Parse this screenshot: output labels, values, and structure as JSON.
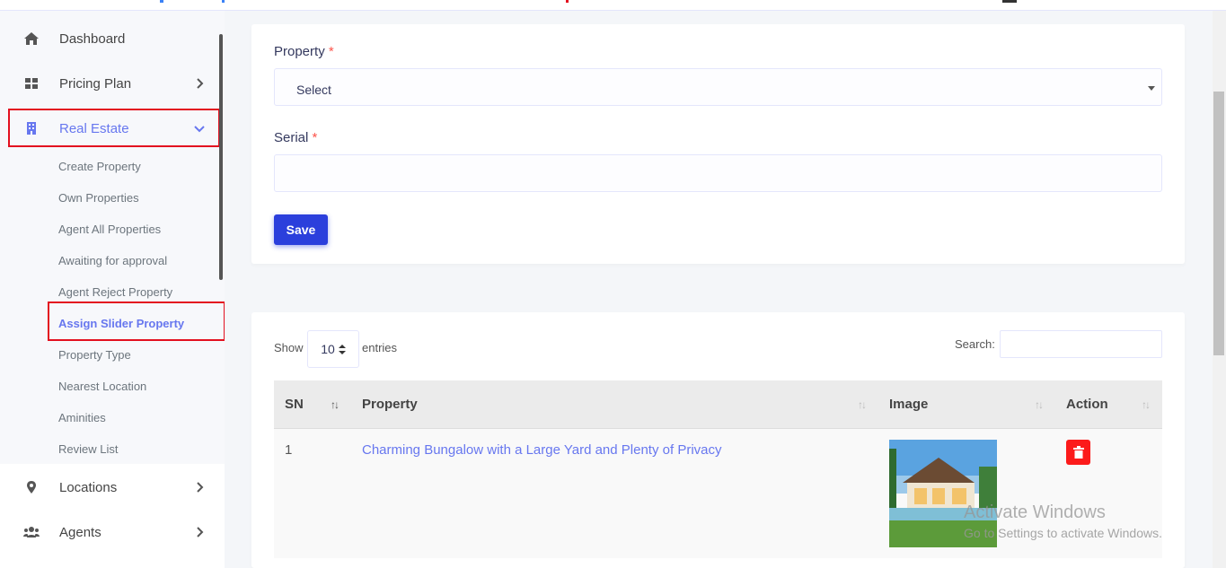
{
  "sidebar": {
    "items": [
      {
        "label": "Dashboard",
        "icon": "home-icon"
      },
      {
        "label": "Pricing Plan",
        "icon": "grid-icon"
      },
      {
        "label": "Real Estate",
        "icon": "building-icon"
      },
      {
        "label": "Locations",
        "icon": "map-marker-icon"
      },
      {
        "label": "Agents",
        "icon": "users-icon"
      }
    ],
    "real_estate_sub": [
      "Create Property",
      "Own Properties",
      "Agent All Properties",
      "Awaiting for approval",
      "Agent Reject Property",
      "Assign Slider Property",
      "Property Type",
      "Nearest Location",
      "Aminities",
      "Review List"
    ]
  },
  "form": {
    "property_label": "Property",
    "property_value": "Select",
    "serial_label": "Serial",
    "serial_value": "",
    "required_mark": "*",
    "save_label": "Save"
  },
  "table_controls": {
    "show_label": "Show",
    "length_value": "10",
    "entries_label": "entries",
    "search_label": "Search:"
  },
  "table": {
    "headers": [
      "SN",
      "Property",
      "Image",
      "Action"
    ],
    "rows": [
      {
        "sn": "1",
        "property": "Charming Bungalow with a Large Yard and Plenty of Privacy"
      }
    ]
  },
  "watermark": {
    "line1": "Activate Windows",
    "line2": "Go to Settings to activate Windows."
  },
  "colors": {
    "accent": "#6777ef",
    "save_button": "#2b3fdc",
    "delete_button": "#fc1b1b",
    "highlight_box": "#e3101f"
  }
}
